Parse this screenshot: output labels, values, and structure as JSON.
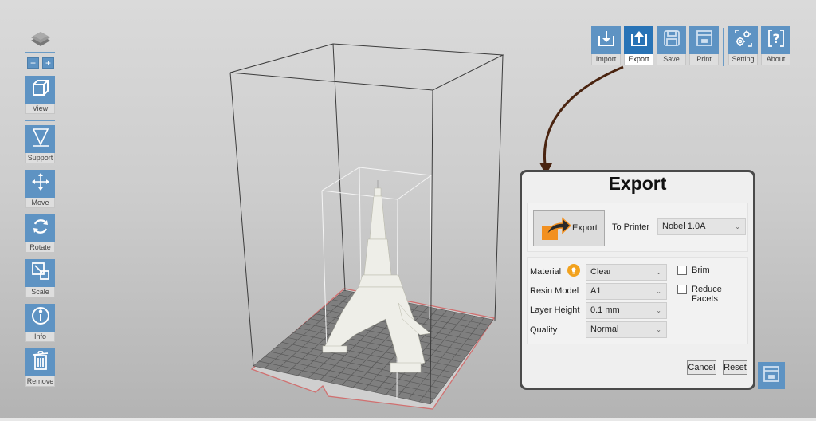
{
  "left_toolbar": {
    "zoom_out": "−",
    "zoom_in": "+",
    "tools": [
      {
        "label": "View",
        "icon": "cube-icon"
      },
      {
        "label": "Support",
        "icon": "support-icon"
      },
      {
        "label": "Move",
        "icon": "move-icon"
      },
      {
        "label": "Rotate",
        "icon": "rotate-icon"
      },
      {
        "label": "Scale",
        "icon": "scale-icon"
      },
      {
        "label": "Info",
        "icon": "info-icon"
      },
      {
        "label": "Remove",
        "icon": "trash-icon"
      }
    ]
  },
  "top_toolbar": {
    "buttons": [
      {
        "label": "Import",
        "icon": "import-icon",
        "active": false
      },
      {
        "label": "Export",
        "icon": "export-icon",
        "active": true
      },
      {
        "label": "Save",
        "icon": "save-icon",
        "active": false
      },
      {
        "label": "Print",
        "icon": "print-icon",
        "active": false
      },
      {
        "label": "Setting",
        "icon": "gear-icon",
        "active": false
      },
      {
        "label": "About",
        "icon": "help-icon",
        "active": false
      }
    ]
  },
  "colors": {
    "accent": "#5e93c3",
    "accent_active": "#2873b6",
    "arrow": "#4a2410",
    "platform_border": "#d07070",
    "export_icon": "#f29020"
  },
  "dialog": {
    "title": "Export",
    "export_button": "Export",
    "to_printer_label": "To Printer",
    "printer": "Nobel 1.0A",
    "material_label": "Material",
    "material": "Clear",
    "resin_model_label": "Resin Model",
    "resin_model": "A1",
    "layer_height_label": "Layer Height",
    "layer_height": "0.1 mm",
    "quality_label": "Quality",
    "quality": "Normal",
    "brim_label": "Brim",
    "brim_checked": false,
    "reduce_facets_label": "Reduce Facets",
    "reduce_facets_checked": false,
    "cancel": "Cancel",
    "reset": "Reset"
  },
  "chevron": "⌄"
}
